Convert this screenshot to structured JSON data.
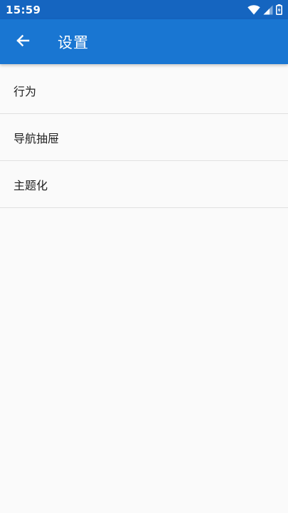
{
  "status_bar": {
    "time": "15:59",
    "icons": [
      "wifi-icon",
      "cell-signal-icon",
      "battery-charging-icon"
    ]
  },
  "app_bar": {
    "back_icon": "arrow-back-icon",
    "title": "设置"
  },
  "settings": {
    "items": [
      {
        "label": "行为"
      },
      {
        "label": "导航抽屉"
      },
      {
        "label": "主题化"
      }
    ]
  },
  "colors": {
    "status_bar": "#1565c0",
    "app_bar": "#1976d2",
    "background": "#fafafa",
    "divider": "#e0e0e0",
    "text": "#212121"
  }
}
